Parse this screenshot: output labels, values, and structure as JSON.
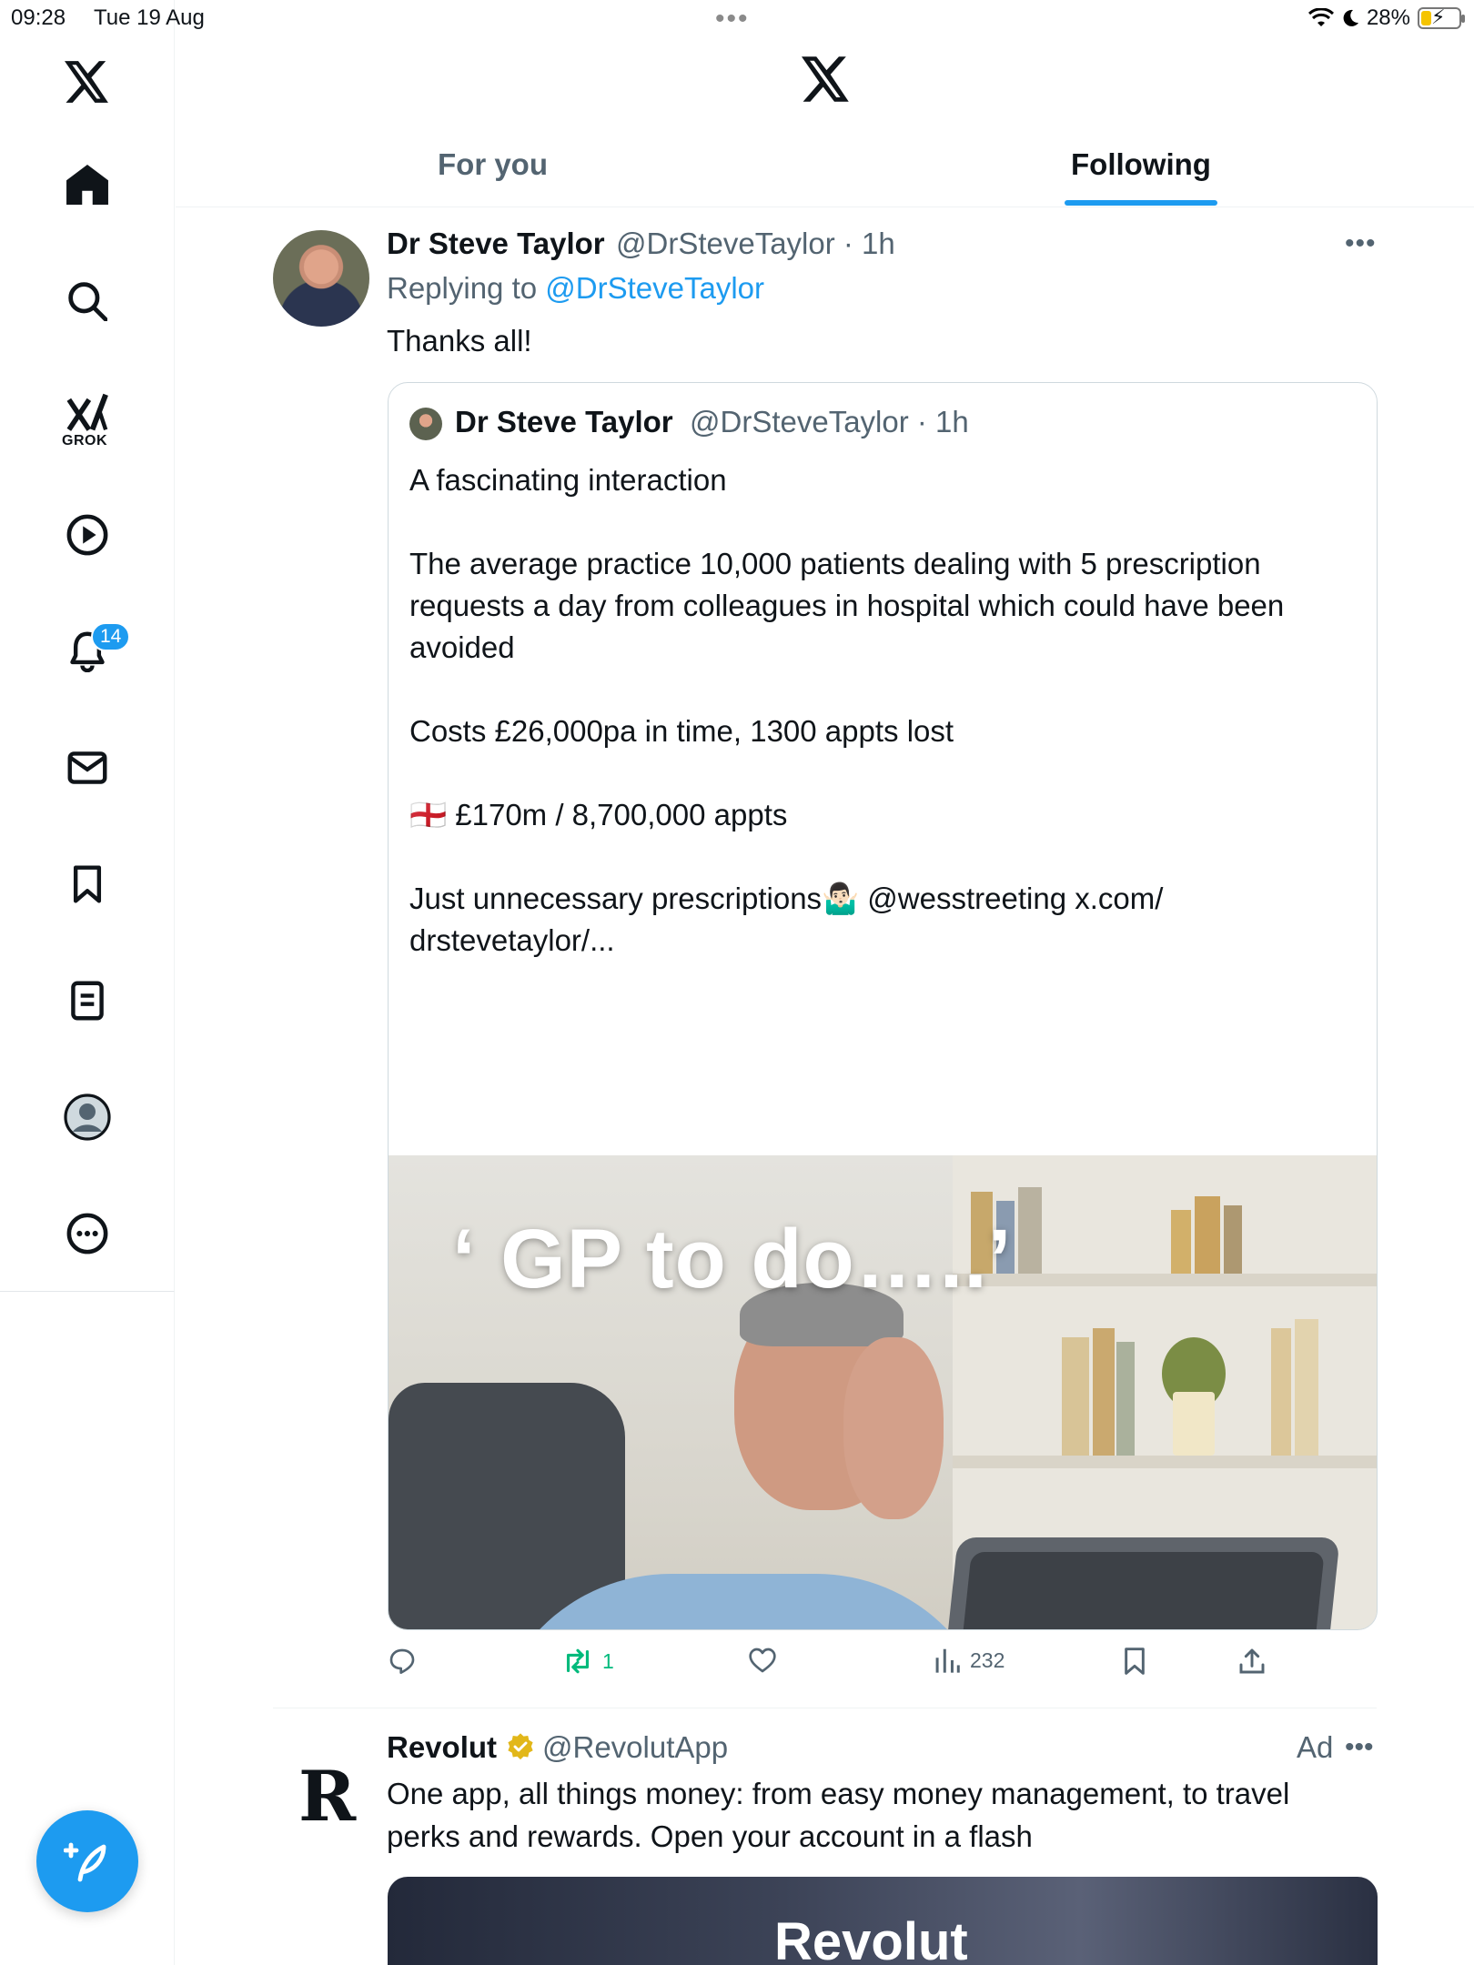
{
  "status_bar": {
    "time": "09:28",
    "date": "Tue 19 Aug",
    "battery_percent_text": "28%",
    "battery_level": 0.28
  },
  "sidebar": {
    "items": [
      {
        "icon": "x-logo-icon"
      },
      {
        "icon": "home-icon"
      },
      {
        "icon": "search-icon"
      },
      {
        "icon": "grok-icon",
        "label": "GROK"
      },
      {
        "icon": "video-play-icon"
      },
      {
        "icon": "notifications-bell-icon",
        "badge": "14"
      },
      {
        "icon": "messages-envelope-icon"
      },
      {
        "icon": "bookmarks-icon"
      },
      {
        "icon": "lists-icon"
      },
      {
        "icon": "profile-avatar-icon"
      },
      {
        "icon": "more-circle-icon"
      }
    ]
  },
  "header": {
    "tabs": [
      {
        "label": "For you",
        "active": false
      },
      {
        "label": "Following",
        "active": true
      }
    ]
  },
  "tweet": {
    "author_name": "Dr Steve Taylor",
    "author_handle_time": "@DrSteveTaylor · 1h",
    "replying_prefix": "Replying to",
    "replying_to": "@DrSteveTaylor",
    "text": "Thanks all!",
    "quote": {
      "author_name": "Dr Steve Taylor",
      "author_handle_time": "@DrSteveTaylor · 1h",
      "text": "A fascinating interaction\n\nThe average practice 10,000 patients dealing with 5 prescription requests a day from colleagues in hospital which could have been avoided\n\nCosts £26,000pa in time, 1300 appts lost\n\n🏴󠁧󠁢󠁥󠁮󠁧󠁿 £170m / 8,700,000 appts\n\nJust unnecessary prescriptions🤷🏻‍♂️ @wesstreeting x.com/\ndrstevetaylor/...",
      "image_caption": "‘ GP to do…..’"
    },
    "actions": {
      "reply_count": "",
      "retweet_count": "1",
      "like_count": "",
      "views_count": "232"
    }
  },
  "ad": {
    "author_name": "Revolut",
    "author_handle": "@RevolutApp",
    "tag": "Ad",
    "logo_letter": "R",
    "text": "One app, all things money: from easy money management, to travel perks and rewards. Open your account in a flash",
    "image_text": "Revolut"
  },
  "colors": {
    "accent": "#1d9bf0",
    "retweet_green": "#00ba7c",
    "secondary_text": "#536471",
    "verified_gold": "#e2b719"
  }
}
